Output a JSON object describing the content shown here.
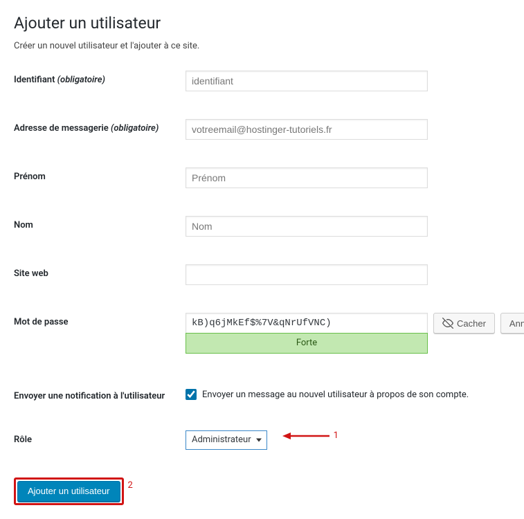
{
  "page": {
    "title": "Ajouter un utilisateur",
    "subtitle": "Créer un nouvel utilisateur et l'ajouter à ce site."
  },
  "labels": {
    "username": "Identifiant",
    "required": "(obligatoire)",
    "email": "Adresse de messagerie",
    "first_name": "Prénom",
    "last_name": "Nom",
    "website": "Site web",
    "password": "Mot de passe",
    "notify": "Envoyer une notification à l'utilisateur",
    "role": "Rôle"
  },
  "placeholders": {
    "username": "identifiant",
    "email": "votreemail@hostinger-tutoriels.fr",
    "first_name": "Prénom",
    "last_name": "Nom"
  },
  "values": {
    "password": "kB)q6jMkEf$%7V&qNrUfVNC)",
    "website": "",
    "role_selected": "Administrateur",
    "notify_checked": true
  },
  "buttons": {
    "hide": "Cacher",
    "cancel": "Annuler",
    "submit": "Ajouter un utilisateur"
  },
  "strength": {
    "label": "Forte"
  },
  "notify_text": "Envoyer un message au nouvel utilisateur à propos de son compte.",
  "annotations": {
    "n1": "1",
    "n2": "2"
  }
}
